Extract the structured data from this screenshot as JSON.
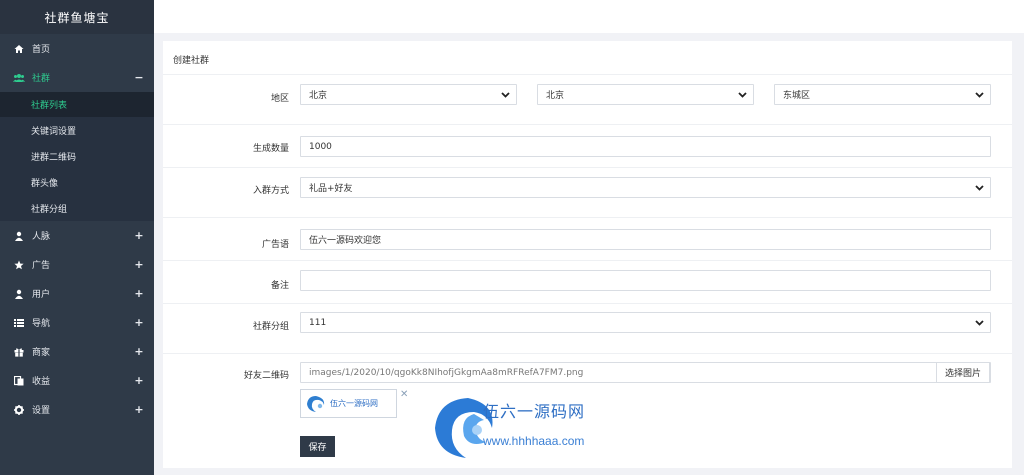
{
  "app": {
    "title": "社群鱼塘宝"
  },
  "sidebar": {
    "items": [
      {
        "label": "首页",
        "icon": "home-icon",
        "sign": ""
      },
      {
        "label": "社群",
        "icon": "group-icon",
        "sign": "−",
        "open": true,
        "children": [
          {
            "label": "社群列表",
            "active": true
          },
          {
            "label": "关键词设置"
          },
          {
            "label": "进群二维码"
          },
          {
            "label": "群头像"
          },
          {
            "label": "社群分组"
          }
        ]
      },
      {
        "label": "人脉",
        "icon": "user-icon",
        "sign": "+"
      },
      {
        "label": "广告",
        "icon": "star-icon",
        "sign": "+"
      },
      {
        "label": "用户",
        "icon": "user-icon",
        "sign": "+"
      },
      {
        "label": "导航",
        "icon": "list-icon",
        "sign": "+"
      },
      {
        "label": "商家",
        "icon": "gift-icon",
        "sign": "+"
      },
      {
        "label": "收益",
        "icon": "copy-icon",
        "sign": "+"
      },
      {
        "label": "设置",
        "icon": "gear-icon",
        "sign": "+"
      }
    ]
  },
  "form": {
    "title": "创建社群",
    "region": {
      "label": "地区",
      "province": "北京",
      "city": "北京",
      "district": "东城区"
    },
    "count": {
      "label": "生成数量",
      "value": "1000"
    },
    "join_mode": {
      "label": "入群方式",
      "value": "礼品+好友"
    },
    "ad_slogan": {
      "label": "广告语",
      "value": "伍六一源码欢迎您"
    },
    "remark": {
      "label": "备注",
      "value": ""
    },
    "group": {
      "label": "社群分组",
      "value": "111"
    },
    "qrcode": {
      "label": "好友二维码",
      "value": "images/1/2020/10/qgoKk8NIhofjGkgmAa8mRFRefA7FM7.png",
      "pick_label": "选择图片",
      "thumb_text": "伍六一源码网"
    },
    "save_label": "保存"
  },
  "watermark": {
    "title": "伍六一源码网",
    "url": "www.hhhhaaa.com"
  },
  "colors": {
    "sidebar_bg": "#2f3a48",
    "accent": "#2ecc8f",
    "page_bg": "#f1f2f6"
  }
}
